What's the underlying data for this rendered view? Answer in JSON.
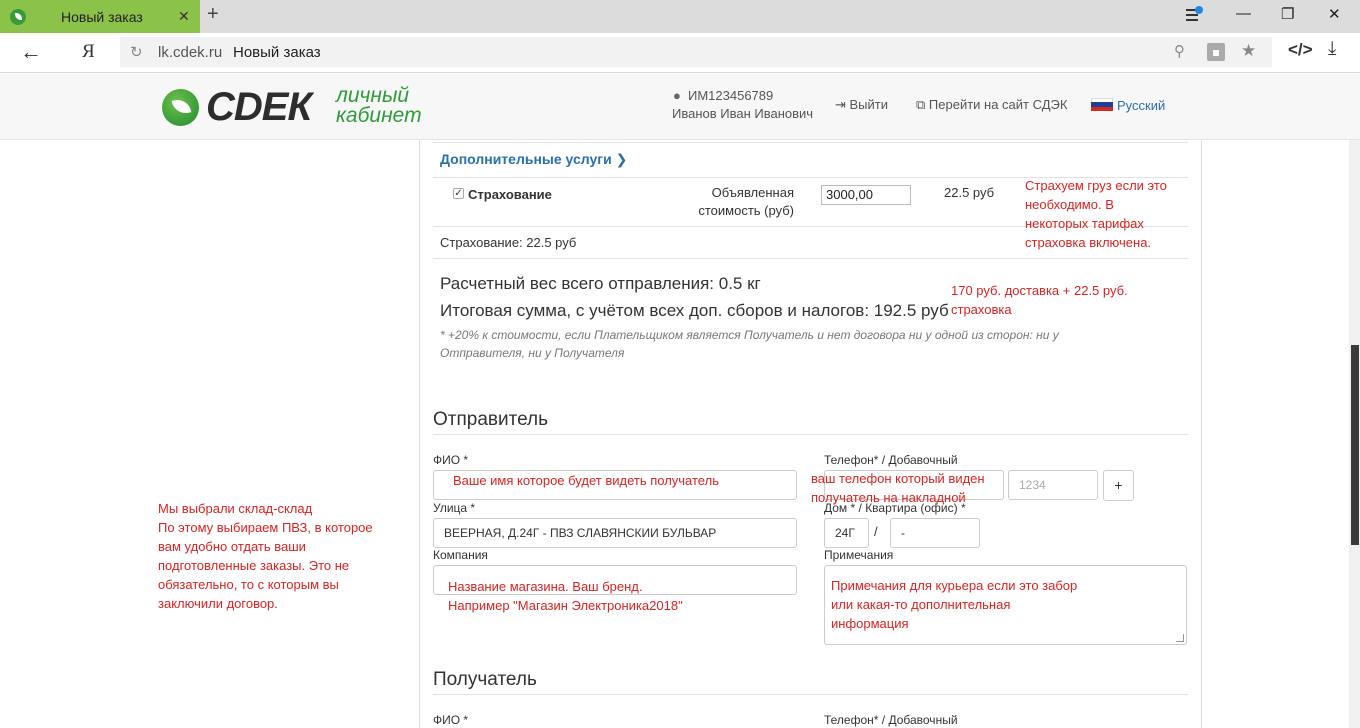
{
  "browser": {
    "tab_title": "Новый заказ",
    "tab_close": "✕",
    "new_tab": "+",
    "window_minimize": "—",
    "window_restore": "❐",
    "window_close": "✕",
    "back": "←",
    "home_icon": "Я",
    "url_domain": "lk.cdek.ru",
    "url_title": "Новый заказ",
    "bookmark_star": "★",
    "download": "⤓",
    "code_view": "</>",
    "notification_color": "#1e88e5"
  },
  "header": {
    "logo_text": "СDЕК",
    "logo_sub_line1": "личный",
    "logo_sub_line2": "кабинет",
    "brand_color": "#2e9b3a",
    "user_login": "ИМ123456789",
    "user_name": "Иванов Иван Иванович",
    "logout": "Выйти",
    "goto_site": "Перейти на сайт СДЭК",
    "language": "Русский"
  },
  "services": {
    "title": "Дополнительные услуги ❯",
    "checkbox": "✓",
    "insurance_label": "Страхование",
    "declared_value_label": "Объявленная стоимость (руб)",
    "declared_value": "3000,00",
    "insurance_price": "22.5 руб",
    "insurance_summary": "Страхование: 22.5 руб"
  },
  "totals": {
    "weight": "Расчетный вес всего отправления: 0.5 кг",
    "sum": "Итоговая сумма, с учётом всех доп. сборов и налогов: 192.5 руб",
    "footnote": "* +20% к стоимости, если Плательщиком является Получатель и нет договора ни у одной из сторон: ни у Отправителя, ни у Получателя"
  },
  "sender": {
    "title": "Отправитель",
    "fio_label": "ФИО *",
    "phone_label": "Телефон* / Добавочный",
    "ext_placeholder": "1234",
    "add_phone": "+",
    "street_label": "Улица *",
    "street_value": "ВЕЕРНАЯ, Д.24Г - ПВЗ СЛАВЯНСКИИ БУЛЬВАР",
    "house_label": "Дом * / Квартира (офис) *",
    "house_value": "24Г",
    "slash": "/",
    "flat_value": "-",
    "company_label": "Компания",
    "notes_label": "Примечания"
  },
  "recipient": {
    "title": "Получатель",
    "fio_label": "ФИО *",
    "phone_label": "Телефон* / Добавочный"
  },
  "annotations": {
    "color": "#dd2222",
    "insurance": [
      "Страхуем груз если это",
      "необходимо. В",
      "некоторых тарифах",
      "страховка включена."
    ],
    "total": [
      "170 руб. доставка + 22.5 руб.",
      "страховка"
    ],
    "name": "Ваше имя которое будет видеть получатель",
    "phone": [
      "ваш телефон который виден",
      "получатель на накладной"
    ],
    "company": [
      "Название магазина. Ваш бренд.",
      "Например \"Магазин Электроника2018\""
    ],
    "notes": [
      "Примечания для курьера если это забор",
      "или какая-то дополнительная",
      "информация"
    ],
    "warehouse": [
      "Мы выбрали склад-склад",
      "По этому выбираем ПВЗ, в которое",
      "вам удобно отдать ваши",
      "подготовленные заказы. Это не",
      "обязательно, то с которым вы",
      "заключили договор."
    ]
  }
}
